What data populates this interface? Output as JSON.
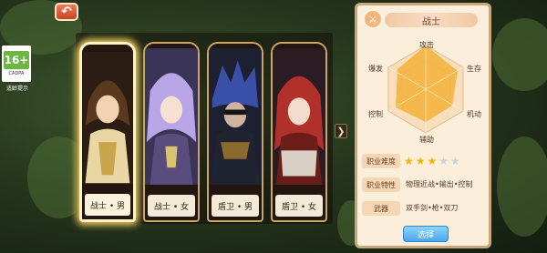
{
  "back_label": "↶",
  "age_rating": {
    "big": "16+",
    "small": "CADPA",
    "tip": "适龄提示"
  },
  "characters": [
    {
      "label": "战士 • 男",
      "hair": "#5a3a1e",
      "armor": "#e8d7a2",
      "selected": true
    },
    {
      "label": "战士 • 女",
      "hair": "#b9a6e6",
      "armor": "#5a4c7c",
      "selected": false
    },
    {
      "label": "盾卫 • 男",
      "hair": "#3a4fa8",
      "armor": "#1f2430",
      "selected": false
    },
    {
      "label": "盾卫 • 女",
      "hair": "#b2302a",
      "armor": "#6b1d1a",
      "selected": false
    }
  ],
  "next_arrow": "❯",
  "panel": {
    "title": "战士",
    "stats": {
      "attack": "攻击",
      "survival": "生存",
      "mobility": "机动",
      "support": "辅助",
      "control": "控制",
      "burst": "爆发"
    },
    "difficulty_label": "职业难度",
    "difficulty_stars": 3,
    "difficulty_max": 5,
    "trait_label": "职业特性",
    "trait_value": "物理近战•输出•控制",
    "weapon_label": "武器",
    "weapon_value": "双手剑•枪•双刀",
    "select_label": "选择"
  },
  "colors": {
    "accent": "#4aa7ea",
    "star_on": "#f5b400",
    "star_off": "#c9d4da",
    "radar_fill": "#f3b13a"
  }
}
